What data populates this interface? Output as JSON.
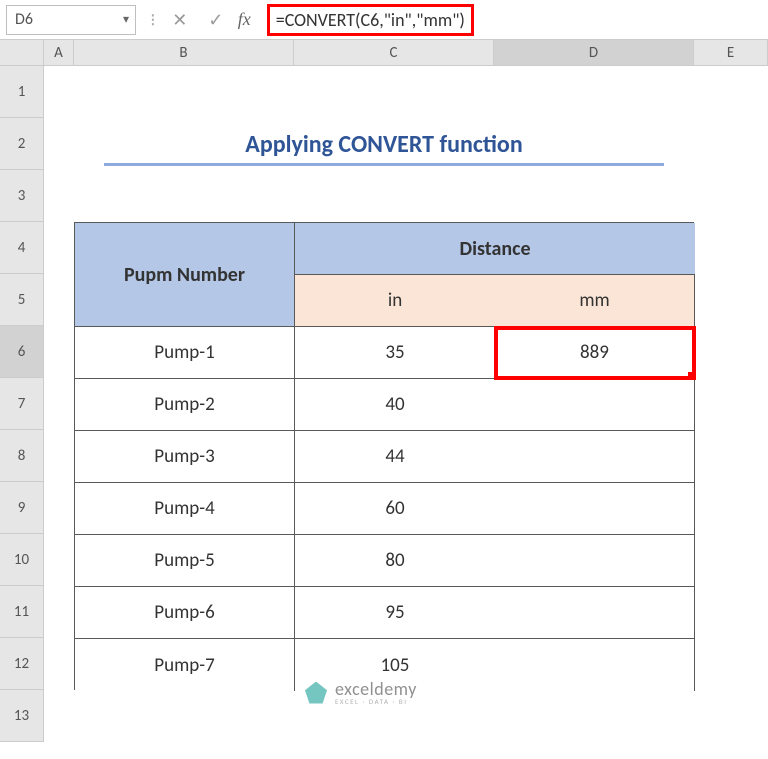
{
  "name_box": "D6",
  "formula": "=CONVERT(C6,\"in\",\"mm\")",
  "columns": [
    "",
    "A",
    "B",
    "C",
    "D",
    "E"
  ],
  "row_nums": [
    "1",
    "2",
    "3",
    "4",
    "5",
    "6",
    "7",
    "8",
    "9",
    "10",
    "11",
    "12",
    "13"
  ],
  "selected_col": "D",
  "selected_row": "6",
  "title": "Applying CONVERT function",
  "table": {
    "col_a_header": "Pupm Number",
    "distance_header": "Distance",
    "sub_in": "in",
    "sub_mm": "mm",
    "rows": [
      {
        "name": "Pump-1",
        "in": "35",
        "mm": "889"
      },
      {
        "name": "Pump-2",
        "in": "40",
        "mm": ""
      },
      {
        "name": "Pump-3",
        "in": "44",
        "mm": ""
      },
      {
        "name": "Pump-4",
        "in": "60",
        "mm": ""
      },
      {
        "name": "Pump-5",
        "in": "80",
        "mm": ""
      },
      {
        "name": "Pump-6",
        "in": "95",
        "mm": ""
      },
      {
        "name": "Pump-7",
        "in": "105",
        "mm": ""
      }
    ]
  },
  "watermark": {
    "main": "exceldemy",
    "sub": "EXCEL · DATA · BI"
  },
  "chart_data": {
    "type": "table",
    "title": "Applying CONVERT function",
    "columns": [
      "Pupm Number",
      "in",
      "mm"
    ],
    "rows": [
      [
        "Pump-1",
        35,
        889
      ],
      [
        "Pump-2",
        40,
        null
      ],
      [
        "Pump-3",
        44,
        null
      ],
      [
        "Pump-4",
        60,
        null
      ],
      [
        "Pump-5",
        80,
        null
      ],
      [
        "Pump-6",
        95,
        null
      ],
      [
        "Pump-7",
        105,
        null
      ]
    ]
  }
}
